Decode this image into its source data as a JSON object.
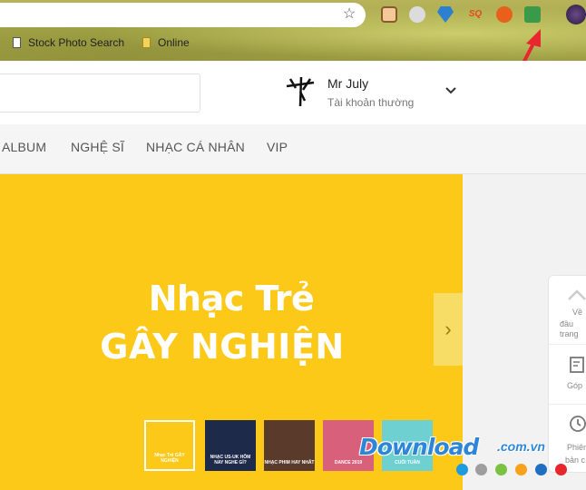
{
  "browser": {
    "bookmarks": [
      {
        "label": "Stock Photo Search",
        "type": "page"
      },
      {
        "label": "Online",
        "type": "folder"
      }
    ],
    "extensions": [
      "profile-ext",
      "shield-ext",
      "diamond-ext",
      "sq-ext",
      "fire-ext",
      "green-ext",
      "avatar-ext"
    ],
    "sq_text": "SQ"
  },
  "header": {
    "user_name": "Mr July",
    "user_type": "Tài khoản thường"
  },
  "nav": {
    "items": [
      "ALBUM",
      "NGHỆ SĨ",
      "NHẠC CÁ NHÂN",
      "VIP"
    ]
  },
  "banner": {
    "line1": "Nhạc Trẻ",
    "line2": "GÂY NGHIỆN",
    "thumbnails": [
      {
        "label": "Nhạc Trẻ GÂY NGHIỆN",
        "color": "#fdc919"
      },
      {
        "label": "NHẠC US-UK HÔM NAY NGHE GÌ?",
        "color": "#1d2a4a"
      },
      {
        "label": "NHẠC PHIM HAY NHẤT",
        "color": "#5a3a2a"
      },
      {
        "label": "DANCE 2019",
        "color": "#d8607a"
      },
      {
        "label": "CUỐI TUẦN",
        "color": "#6ed0d0"
      }
    ]
  },
  "side_panel": {
    "items": [
      {
        "icon": "chevron-up-icon",
        "label_l1": "Về",
        "label_l2": "đầu trang"
      },
      {
        "icon": "feedback-icon",
        "label_l1": "Góp",
        "label_l2": ""
      },
      {
        "icon": "history-icon",
        "label_l1": "Phiên",
        "label_l2": "bản c"
      }
    ]
  },
  "watermark": {
    "main": "Download",
    "sub": ".com.vn",
    "dots": [
      "#1e9be0",
      "#9e9e9e",
      "#7cc242",
      "#f7a21b",
      "#1e6fc0",
      "#e8262d"
    ]
  }
}
